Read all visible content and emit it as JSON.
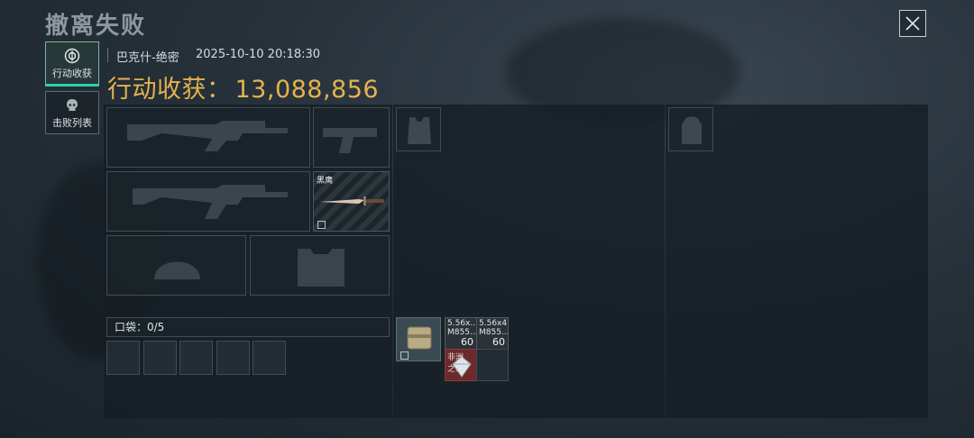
{
  "header": {
    "title": "撤离失败",
    "close_icon": "close-icon"
  },
  "tabs": [
    {
      "label": "行动收获",
      "icon": "target-icon",
      "active": true
    },
    {
      "label": "击败列表",
      "icon": "skull-icon",
      "active": false
    }
  ],
  "info": {
    "map": "巴克什-绝密",
    "datetime": "2025-10-10 20:18:30"
  },
  "earnings": {
    "label": "行动收获：",
    "value": "13,088,856"
  },
  "equipment": {
    "primary_weapon_icon": "rifle-silhouette-icon",
    "secondary_weapon_icon": "rifle-silhouette-icon",
    "pistol_icon": "pistol-silhouette-icon",
    "melee": {
      "name": "黑鹰",
      "icon": "knife-icon",
      "bound": true
    },
    "helmet_icon": "helmet-silhouette-icon",
    "armor_icon": "armor-silhouette-icon",
    "rig_icon": "chest-rig-silhouette-icon",
    "backpack_icon": "backpack-silhouette-icon"
  },
  "pocket": {
    "label": "口袋：0/5"
  },
  "container_items": [
    {
      "type": "case",
      "icon": "wallet-case-icon",
      "bound": true
    },
    {
      "type": "ammo",
      "name_line1": "5.56x...",
      "name_line2": "M855...",
      "count": "60"
    },
    {
      "type": "ammo",
      "name_line1": "5.56x4...",
      "name_line2": "M855...",
      "count": "60"
    },
    {
      "type": "valuable",
      "name": "非洲之...",
      "icon": "diamond-icon"
    }
  ],
  "colors": {
    "accent": "#e5b24f",
    "tab_active": "#2fd0a7",
    "valuable_bg": "#6b2a2c"
  }
}
